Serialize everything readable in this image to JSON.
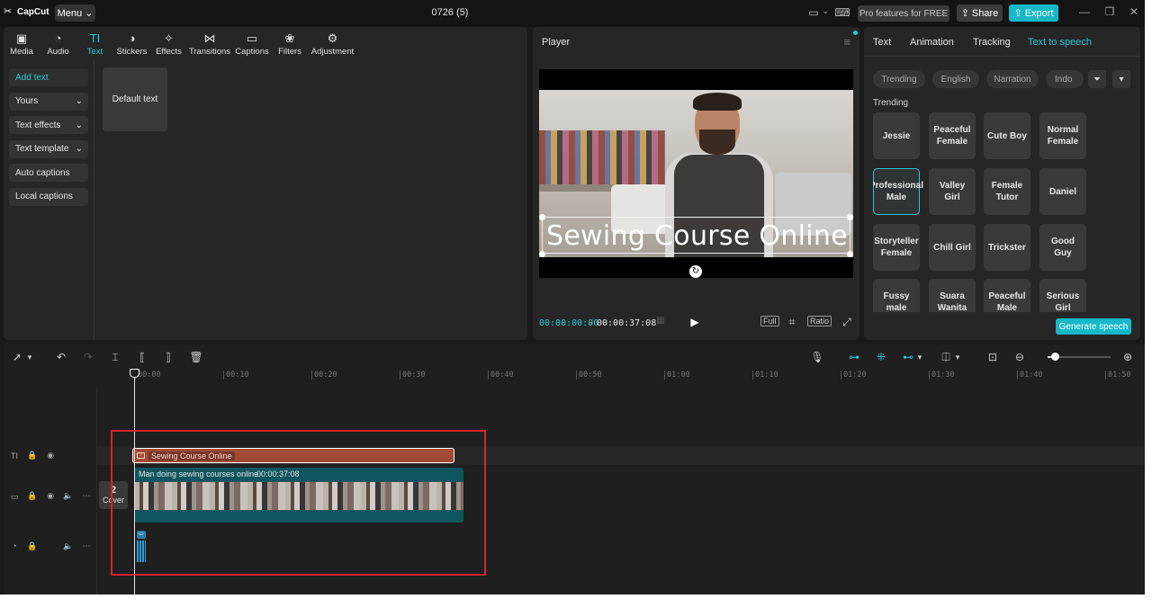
{
  "titlebar": {
    "app_name": "CapCut",
    "menu_label": "Menu",
    "project_title": "0726 (5)",
    "pro_label": "Pro features for FREE",
    "share_label": "Share",
    "export_label": "Export"
  },
  "tools": [
    {
      "label": "Media",
      "icon": "media-icon",
      "glyph": "▣"
    },
    {
      "label": "Audio",
      "icon": "audio-icon",
      "glyph": "◔"
    },
    {
      "label": "Text",
      "icon": "text-icon",
      "glyph": "TI",
      "active": true
    },
    {
      "label": "Stickers",
      "icon": "stickers-icon",
      "glyph": "◑"
    },
    {
      "label": "Effects",
      "icon": "effects-icon",
      "glyph": "✧"
    },
    {
      "label": "Transitions",
      "icon": "transitions-icon",
      "glyph": "⋈"
    },
    {
      "label": "Captions",
      "icon": "captions-icon",
      "glyph": "▭"
    },
    {
      "label": "Filters",
      "icon": "filters-icon",
      "glyph": "❀"
    },
    {
      "label": "Adjustment",
      "icon": "adjustment-icon",
      "glyph": "⚙"
    }
  ],
  "text_sidebar": [
    {
      "label": "Add text",
      "active": true,
      "has_chevron": false
    },
    {
      "label": "Yours",
      "has_chevron": true
    },
    {
      "label": "Text effects",
      "has_chevron": true
    },
    {
      "label": "Text template",
      "has_chevron": true
    },
    {
      "label": "Auto captions",
      "has_chevron": false
    },
    {
      "label": "Local captions",
      "has_chevron": false
    }
  ],
  "default_text_card": "Default text",
  "player": {
    "title": "Player",
    "overlay_text": "Sewing Course Online",
    "current_time": "00:00:00:00",
    "total_time": "00:00:37:08",
    "full_label": "Full",
    "ratio_label": "Ratio"
  },
  "right_panel": {
    "tabs": [
      {
        "label": "Text"
      },
      {
        "label": "Animation"
      },
      {
        "label": "Tracking"
      },
      {
        "label": "Text to speech",
        "active": true
      }
    ],
    "filters": [
      "Trending",
      "English",
      "Narration",
      "Indo"
    ],
    "section_label": "Trending",
    "voices": [
      "Jessie",
      "Peaceful Female",
      "Cute Boy",
      "Normal Female",
      "Professional Male",
      "Valley Girl",
      "Female Tutor",
      "Daniel",
      "Storyteller Female",
      "Chill Girl",
      "Trickster",
      "Good Guy",
      "Fussy male",
      "Suara Wanita",
      "Peaceful Male",
      "Serious Girl"
    ],
    "selected_voice": "Professional Male",
    "generate_label": "Generate speech"
  },
  "timeline": {
    "ruler": [
      "00:00",
      "00:10",
      "00:20",
      "00:30",
      "00:40",
      "00:50",
      "01:00",
      "01:10",
      "01:20",
      "01:30",
      "01:40",
      "01:50"
    ],
    "text_clip": "Sewing Course Online",
    "video_clip_label": "Man doing sewing courses online",
    "video_clip_duration": "00:00:37:08",
    "cover_number": "2",
    "cover_label": "Cover"
  },
  "colors": {
    "accent": "#2bc7d6",
    "export": "#16b8c8",
    "text_clip": "#a14a35",
    "video_clip": "#0f5560",
    "highlight": "#d6232e"
  }
}
